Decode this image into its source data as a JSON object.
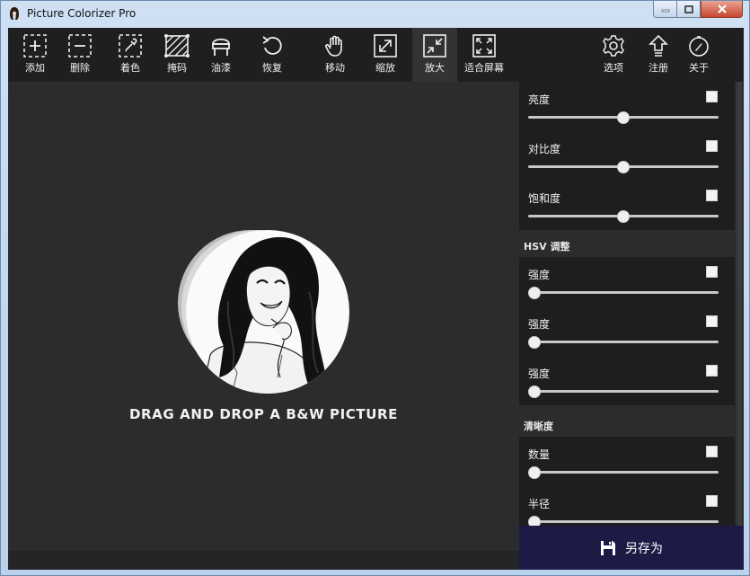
{
  "window": {
    "title": "Picture Colorizer Pro"
  },
  "toolbar": {
    "add": "添加",
    "delete": "删除",
    "colorize": "着色",
    "mask": "掩码",
    "paint": "油漆",
    "restore": "恢复",
    "move": "移动",
    "scale": "缩放",
    "zoom_in": "放大",
    "fit_screen": "适合屏幕",
    "options": "选项",
    "register": "注册",
    "about": "关于"
  },
  "canvas": {
    "drop_hint": "DRAG AND DROP A B&W PICTURE"
  },
  "panel": {
    "basic": [
      {
        "label": "亮度",
        "value": 0.5
      },
      {
        "label": "对比度",
        "value": 0.5
      },
      {
        "label": "饱和度",
        "value": 0.5
      }
    ],
    "hsv_title": "HSV 调整",
    "hsv": [
      {
        "label": "强度",
        "value": 0.0
      },
      {
        "label": "强度",
        "value": 0.0
      },
      {
        "label": "强度",
        "value": 0.0
      }
    ],
    "sharpness_title": "清晰度",
    "sharpness": [
      {
        "label": "数量",
        "value": 0.0
      },
      {
        "label": "半径",
        "value": 0.0
      }
    ]
  },
  "save_button": {
    "label": "另存为"
  },
  "colors": {
    "accent": "#1d1a45",
    "toolbar_bg": "#1f1f21",
    "canvas_bg": "#2c2c2e"
  }
}
